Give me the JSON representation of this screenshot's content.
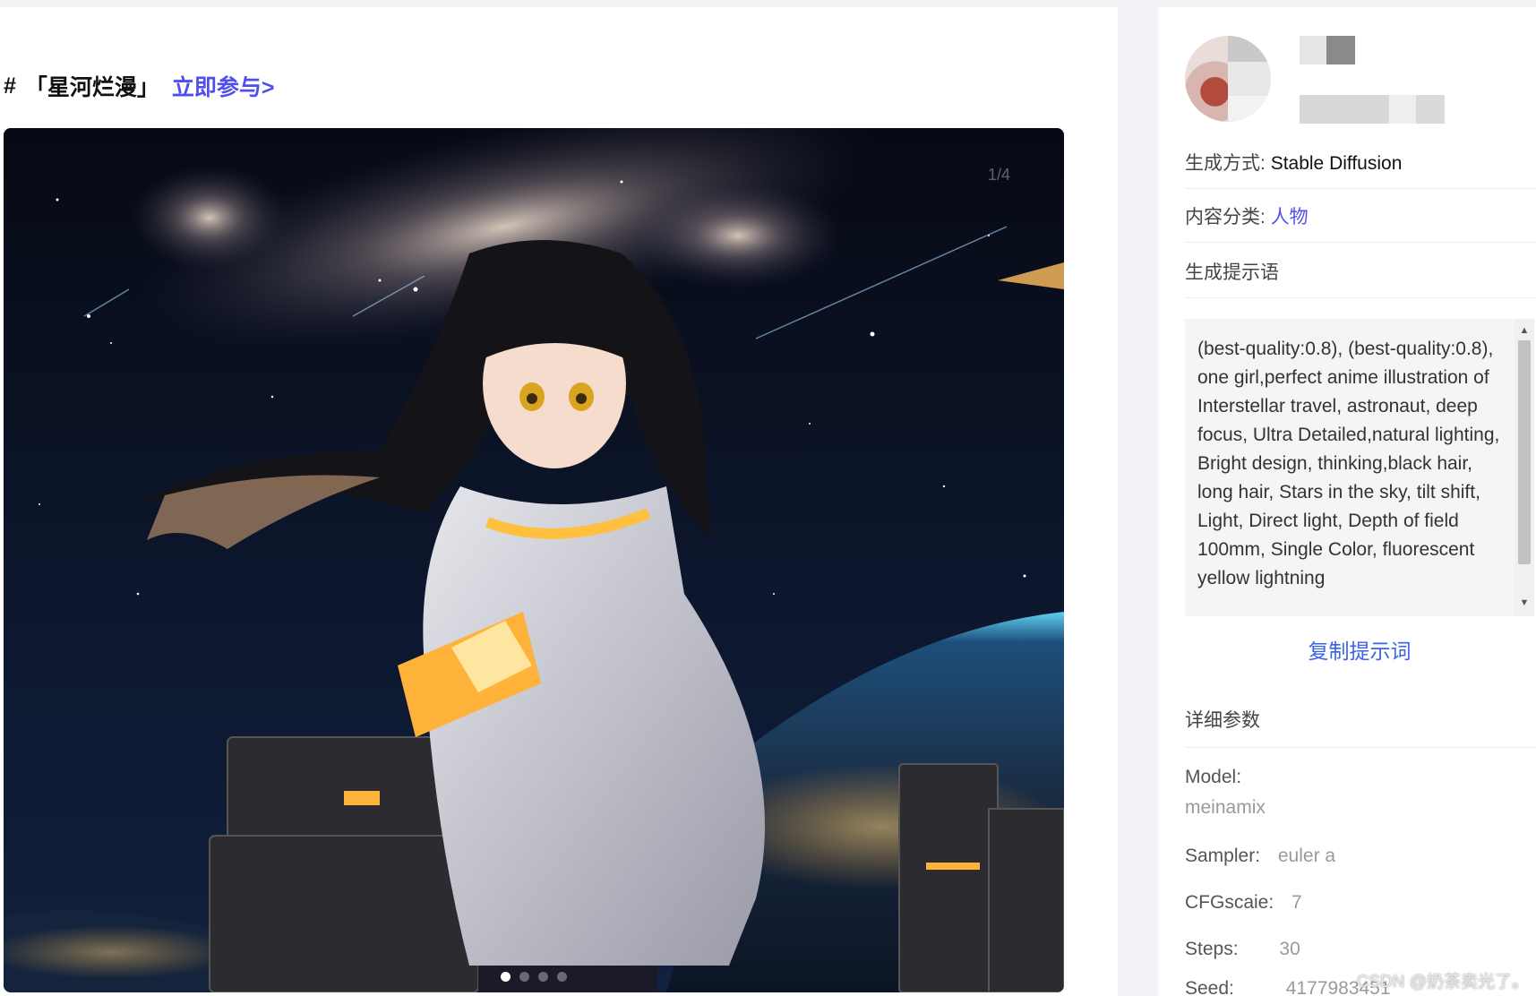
{
  "topic": {
    "hash": "#",
    "name": "「星河烂漫」",
    "link": "立即参与>"
  },
  "viewer": {
    "counter": "1/4",
    "slide_count": 4,
    "active_slide": 1
  },
  "details": {
    "method_label": "生成方式:",
    "method_value": "Stable Diffusion",
    "category_label": "内容分类:",
    "category_value": "人物",
    "prompt_label": "生成提示语",
    "prompt_text": "(best-quality:0.8), (best-quality:0.8), one girl,perfect anime illustration of Interstellar travel, astronaut, deep focus, Ultra Detailed,natural lighting, Bright design, thinking,black hair, long hair, Stars in the sky, tilt shift, Light, Direct light, Depth of field 100mm, Single Color, fluorescent yellow lightning",
    "copy_button": "复制提示词",
    "params_title": "详细参数"
  },
  "params": {
    "model_label": "Model:",
    "model_value": "meinamix",
    "sampler_label": "Sampler:",
    "sampler_value": "euler a",
    "cfg_label": "CFGscaie:",
    "cfg_value": "7",
    "steps_label": "Steps:",
    "steps_value": "30",
    "seed_label": "Seed:",
    "seed_value": "4177983451"
  },
  "watermark": "CSDN @奶茶卖光了。"
}
